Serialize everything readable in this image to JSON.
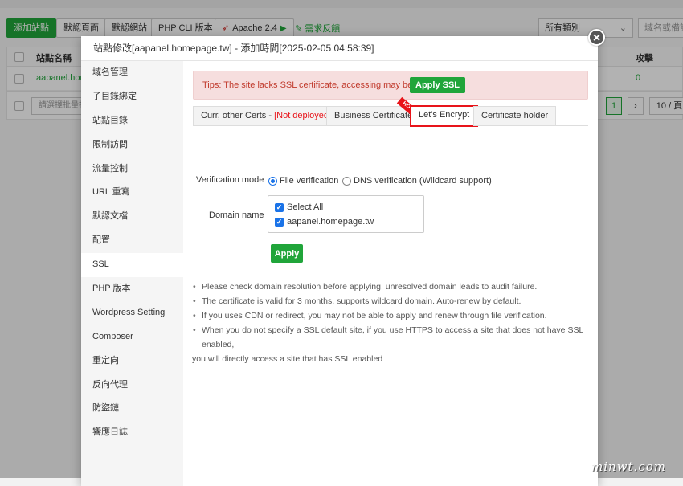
{
  "background": {
    "toolbar": {
      "add_site": "添加站點",
      "default_page": "默認頁面",
      "default_site": "默認網站",
      "php_cli": "PHP CLI 版本",
      "apache": "Apache 2.4",
      "feedback": "需求反饋",
      "category_select": "所有類別",
      "search_placeholder": "域名或備註"
    },
    "table": {
      "col_name": "站點名稱",
      "col_attack": "攻擊",
      "row_site": "aapanel.home",
      "row_attack": "0"
    },
    "footer": {
      "batch_placeholder": "請選擇批量操作",
      "current_page": "1",
      "page_size": "10 / 頁"
    }
  },
  "modal": {
    "title": "站點修改[aapanel.homepage.tw] - 添加時間[2025-02-05 04:58:39]",
    "close_icon": "×",
    "nav": [
      {
        "label": "域名管理"
      },
      {
        "label": "子目錄綁定"
      },
      {
        "label": "站點目錄"
      },
      {
        "label": "限制訪問"
      },
      {
        "label": "流量控制"
      },
      {
        "label": "URL 重寫"
      },
      {
        "label": "默認文檔"
      },
      {
        "label": "配置"
      },
      {
        "label": "SSL"
      },
      {
        "label": "PHP 版本"
      },
      {
        "label": "Wordpress Setting"
      },
      {
        "label": "Composer"
      },
      {
        "label": "重定向"
      },
      {
        "label": "反向代理"
      },
      {
        "label": "防盜鏈"
      },
      {
        "label": "響應日誌"
      }
    ],
    "active_nav": "SSL",
    "tips": {
      "text": "Tips: The site lacks SSL certificate, accessing may be risky.",
      "button": "Apply SSL"
    },
    "tabs": {
      "curr_certs": "Curr, other Certs - ",
      "not_deployed": "[Not deployed]",
      "business": "Business Certificate",
      "hot_badge": "HOT",
      "lets_encrypt": "Let's Encrypt",
      "holder": "Certificate holder"
    },
    "verification": {
      "label": "Verification mode",
      "file": "File verification",
      "dns": "DNS verification (Wildcard support)",
      "selected": "file"
    },
    "domain": {
      "label": "Domain name",
      "select_all": "Select All",
      "domain": "aapanel.homepage.tw"
    },
    "apply_button": "Apply",
    "notes": [
      "Please check domain resolution before applying, unresolved domain leads to audit failure.",
      "The certificate is valid for 3 months, supports wildcard domain. Auto-renew by default.",
      "If you uses CDN or redirect, you may not be able to apply and renew through file verification.",
      "When you do not specify a SSL default site, if you use HTTPS to access a site that does not have SSL enabled,"
    ],
    "note_continuation": "you will directly access a site that has SSL enabled"
  },
  "watermark": "minwt.com",
  "colors": {
    "accent_green": "#20a53a",
    "alert_red": "#e8141a",
    "tip_bg": "#f6dede",
    "check_blue": "#1a73e8"
  }
}
